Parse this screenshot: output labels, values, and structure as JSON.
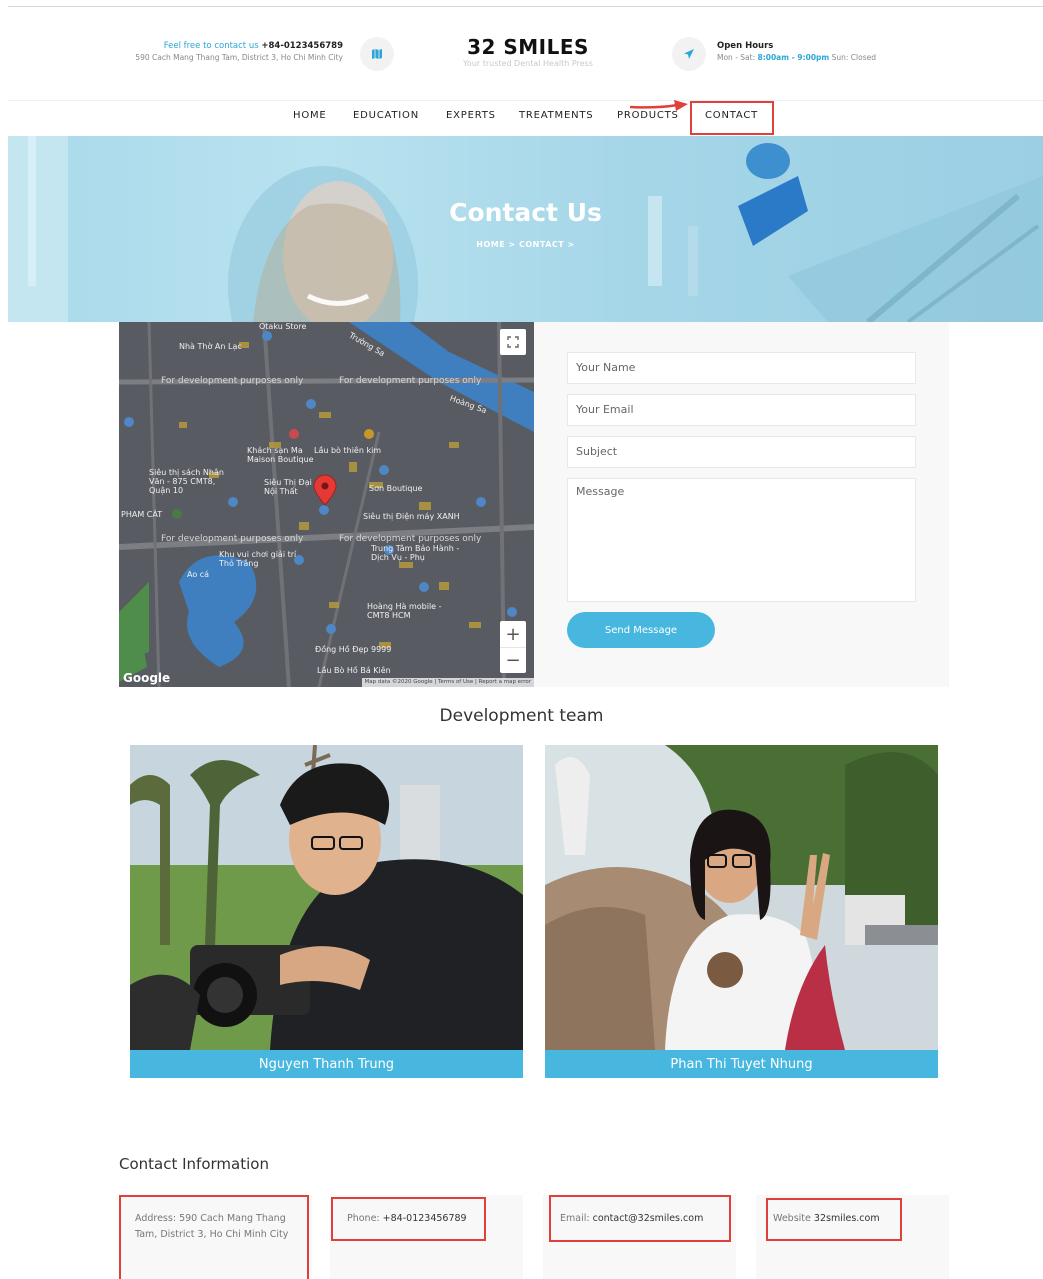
{
  "header": {
    "contact_prefix": "Feel free to contact us",
    "contact_phone": "+84-0123456789",
    "address": "590 Cach Mang Thang Tam, District 3, Ho Chi Minh City",
    "logo_title": "32 SMILES",
    "logo_subtitle": "Your trusted Dental Health Press",
    "hours_title": "Open Hours",
    "hours_prefix": "Mon - Sat:",
    "hours_value": "8:00am - 9:00pm",
    "hours_suffix": "Sun: Closed",
    "map_icon": "map-icon",
    "send_icon": "paper-plane-icon"
  },
  "nav": {
    "items": [
      "HOME",
      "EDUCATION",
      "EXPERTS",
      "TREATMENTS",
      "PRODUCTS",
      "CONTACT"
    ]
  },
  "hero": {
    "title": "Contact Us",
    "breadcrumb": "HOME >  CONTACT >"
  },
  "map": {
    "labels": [
      "Otaku Store",
      "Nhà Thờ An Lạc",
      "For development purposes only",
      "Khách sạn Ma Maison Boutique",
      "Lầu bò thiên kim",
      "Siêu thị sách Nhân Văn - 875 CMT8, Quận 10",
      "Siêu Thị Đại Nội Thất",
      "Sơn Boutique",
      "Siêu thị Điện máy XANH",
      "Khu vui chơi giải trí Thỏ Trắng",
      "Trung Tâm Bảo Hành - Dịch Vụ - Phụ",
      "Hoàng Hà mobile - CMT8 HCM",
      "Đồng Hồ Đẹp 9999",
      "Lầu Bò Hồ Bá Kiên",
      "PHAM CÁT",
      "Ao cá",
      "Trường Sa",
      "Hoàng Sa"
    ],
    "google": "Google",
    "attribution": "Map data ©2020 Google | Terms of Use | Report a map error"
  },
  "form": {
    "name_placeholder": "Your Name",
    "email_placeholder": "Your Email",
    "subject_placeholder": "Subject",
    "message_placeholder": "Message",
    "send_label": "Send Message"
  },
  "team": {
    "title": "Development team",
    "members": [
      {
        "name": "Nguyen Thanh Trung"
      },
      {
        "name": "Phan Thi Tuyet Nhung"
      }
    ]
  },
  "contact_info": {
    "title": "Contact Information",
    "address_label": "Address:",
    "address_value": "590 Cach Mang Thang Tam, District 3, Ho Chi Minh City",
    "phone_label": "Phone:",
    "phone_value": "+84-0123456789",
    "email_label": "Email:",
    "email_value": "contact@32smiles.com",
    "website_label": "Website",
    "website_value": "32smiles.com"
  },
  "colors": {
    "accent": "#48b7df",
    "highlight_box": "#e0403a"
  }
}
